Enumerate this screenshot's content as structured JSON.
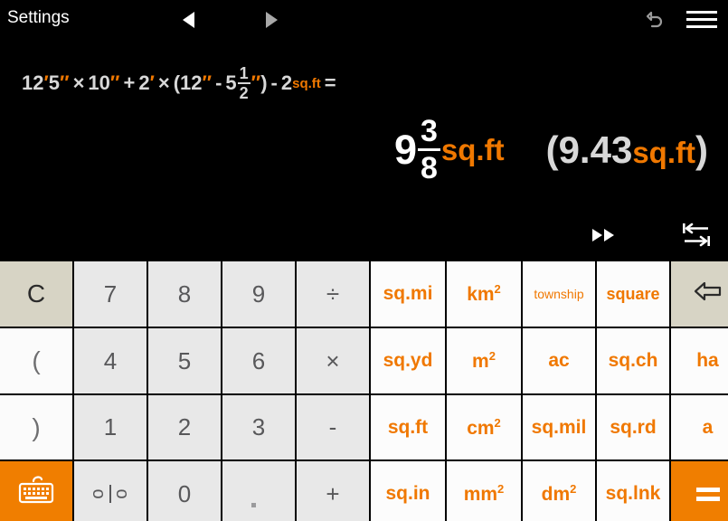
{
  "header": {
    "settings_label": "Settings",
    "prev_icon": "triangle-left-icon",
    "next_icon": "triangle-right-icon",
    "undo_icon": "undo-arrow-icon",
    "menu_icon": "hamburger-menu-icon"
  },
  "display": {
    "expression": {
      "full_text": "12'5\" × 10\" + 2' × (12\" - 5 1/2 \") - 2sq.ft =",
      "tokens": [
        {
          "t": "12",
          "k": "num"
        },
        {
          "t": "′",
          "k": "prime"
        },
        {
          "t": "5",
          "k": "num"
        },
        {
          "t": "″",
          "k": "prime"
        },
        {
          "t": "×",
          "k": "op"
        },
        {
          "t": "10",
          "k": "num"
        },
        {
          "t": "″",
          "k": "prime"
        },
        {
          "t": "+",
          "k": "op"
        },
        {
          "t": "2",
          "k": "num"
        },
        {
          "t": "′",
          "k": "prime"
        },
        {
          "t": "×",
          "k": "op"
        },
        {
          "t": "(",
          "k": "num"
        },
        {
          "t": "12",
          "k": "num"
        },
        {
          "t": "″",
          "k": "prime"
        },
        {
          "t": "-",
          "k": "op"
        },
        {
          "t": "5",
          "k": "num"
        },
        {
          "t": "1/2",
          "k": "frac"
        },
        {
          "t": "″",
          "k": "prime"
        },
        {
          "t": ")",
          "k": "num"
        },
        {
          "t": "-",
          "k": "op"
        },
        {
          "t": "2",
          "k": "num"
        },
        {
          "t": "sq.ft",
          "k": "unit"
        },
        {
          "t": "=",
          "k": "op"
        }
      ],
      "expr_part1": "12",
      "expr_prime1": "′",
      "expr_part2": "5",
      "expr_prime2": "″",
      "expr_mul1": "×",
      "expr_part3": "10",
      "expr_prime3": "″",
      "expr_plus": "+",
      "expr_part4": "2",
      "expr_prime4": "′",
      "expr_mul2": "×",
      "expr_open": "(",
      "expr_part5": "12",
      "expr_prime5": "″",
      "expr_minus1": "-",
      "expr_part6": "5",
      "frac_num": "1",
      "frac_den": "2",
      "expr_prime6": "″",
      "expr_close": ")",
      "expr_minus2": "-",
      "expr_part7": "2",
      "expr_unit": "sq.ft",
      "expr_equals": "="
    },
    "result": {
      "whole": "9",
      "frac_num": "3",
      "frac_den": "8",
      "unit": "sq.ft",
      "alt_open": "(",
      "alt_value": "9.43",
      "alt_unit": "sq.ft",
      "alt_close": ")"
    },
    "tools": {
      "fast_forward_icon": "fast-forward-icon",
      "convert_icon": "swap-convert-icon"
    }
  },
  "keypad": {
    "rows": [
      [
        {
          "label": "C",
          "name": "clear-key",
          "style": "clear"
        },
        {
          "label": "7",
          "name": "digit-7-key",
          "style": "digit"
        },
        {
          "label": "8",
          "name": "digit-8-key",
          "style": "digit"
        },
        {
          "label": "9",
          "name": "digit-9-key",
          "style": "digit"
        },
        {
          "label": "÷",
          "name": "divide-key",
          "style": "digit"
        },
        {
          "label": "sq.mi",
          "name": "unit-sqmi-key",
          "style": "unit"
        },
        {
          "label": "km²",
          "name": "unit-km2-key",
          "style": "unit"
        },
        {
          "label": "township",
          "name": "unit-township-key",
          "style": "unit small"
        },
        {
          "label": "square",
          "name": "unit-square-key",
          "style": "unit med"
        },
        {
          "label": "⇦",
          "name": "backspace-key",
          "style": "back"
        }
      ],
      [
        {
          "label": "(",
          "name": "open-paren-key",
          "style": "paren"
        },
        {
          "label": "4",
          "name": "digit-4-key",
          "style": "digit"
        },
        {
          "label": "5",
          "name": "digit-5-key",
          "style": "digit"
        },
        {
          "label": "6",
          "name": "digit-6-key",
          "style": "digit"
        },
        {
          "label": "×",
          "name": "multiply-key",
          "style": "digit"
        },
        {
          "label": "sq.yd",
          "name": "unit-sqyd-key",
          "style": "unit"
        },
        {
          "label": "m²",
          "name": "unit-m2-key",
          "style": "unit"
        },
        {
          "label": "ac",
          "name": "unit-ac-key",
          "style": "unit"
        },
        {
          "label": "sq.ch",
          "name": "unit-sqch-key",
          "style": "unit"
        },
        {
          "label": "ha",
          "name": "unit-ha-key",
          "style": "unit"
        }
      ],
      [
        {
          "label": ")",
          "name": "close-paren-key",
          "style": "paren"
        },
        {
          "label": "1",
          "name": "digit-1-key",
          "style": "digit"
        },
        {
          "label": "2",
          "name": "digit-2-key",
          "style": "digit"
        },
        {
          "label": "3",
          "name": "digit-3-key",
          "style": "digit"
        },
        {
          "label": "-",
          "name": "minus-key",
          "style": "digit"
        },
        {
          "label": "sq.ft",
          "name": "unit-sqft-key",
          "style": "unit"
        },
        {
          "label": "cm²",
          "name": "unit-cm2-key",
          "style": "unit"
        },
        {
          "label": "sq.mil",
          "name": "unit-sqmil-key",
          "style": "unit"
        },
        {
          "label": "sq.rd",
          "name": "unit-sqrd-key",
          "style": "unit"
        },
        {
          "label": "a",
          "name": "unit-a-key",
          "style": "unit"
        }
      ],
      [
        {
          "label": "",
          "name": "keyboard-key",
          "style": "orange"
        },
        {
          "label": "",
          "name": "fraction-key",
          "style": "frac-key"
        },
        {
          "label": "0",
          "name": "digit-0-key",
          "style": "digit"
        },
        {
          "label": ".",
          "name": "decimal-point-key",
          "style": "dot"
        },
        {
          "label": "+",
          "name": "plus-key",
          "style": "digit"
        },
        {
          "label": "sq.in",
          "name": "unit-sqin-key",
          "style": "unit"
        },
        {
          "label": "mm²",
          "name": "unit-mm2-key",
          "style": "unit"
        },
        {
          "label": "dm²",
          "name": "unit-dm2-key",
          "style": "unit"
        },
        {
          "label": "sq.lnk",
          "name": "unit-sqlnk-key",
          "style": "unit"
        },
        {
          "label": "=",
          "name": "equals-key",
          "style": "orange"
        }
      ]
    ],
    "fraction_key_glyph": {
      "num": "o",
      "den": "o"
    },
    "keyboard_icon": "keyboard-icon",
    "equals_icon": "equals-icon"
  },
  "colors": {
    "accent_orange": "#f07800",
    "key_orange": "#f07e00",
    "display_bg": "#000000",
    "digit_key_bg": "#e8e8e8",
    "clear_key_bg": "#d7d4c5",
    "unit_key_bg": "#fcfcfc",
    "digit_text": "#58585a",
    "expr_text": "#d8d8d8",
    "result_text": "#ffffff"
  }
}
